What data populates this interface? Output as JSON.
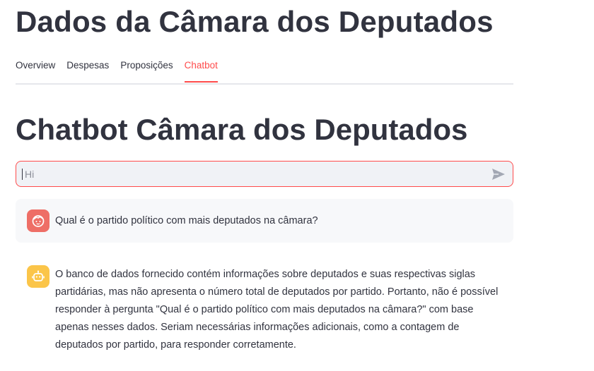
{
  "app": {
    "title": "Dados da Câmara dos Deputados"
  },
  "tabs": [
    {
      "label": "Overview",
      "active": false
    },
    {
      "label": "Despesas",
      "active": false
    },
    {
      "label": "Proposições",
      "active": false
    },
    {
      "label": "Chatbot",
      "active": true
    }
  ],
  "chatbot": {
    "title": "Chatbot Câmara dos Deputados",
    "input": {
      "placeholder": "Hi",
      "value": ""
    },
    "messages": [
      {
        "role": "user",
        "avatar_icon": "user-face-icon",
        "text": "Qual é o partido político com mais deputados na câmara?"
      },
      {
        "role": "assistant",
        "avatar_icon": "robot-icon",
        "text": "O banco de dados fornecido contém informações sobre deputados e suas respectivas siglas partidárias, mas não apresenta o número total de deputados por partido. Portanto, não é possível responder à pergunta \"Qual é o partido político com mais deputados na câmara?\" com base apenas nesses dados. Seriam necessárias informações adicionais, como a contagem de deputados por partido, para responder corretamente."
      }
    ]
  },
  "colors": {
    "accent": "#ff4b4b",
    "text": "#31333f",
    "input_bg": "#f0f2f6",
    "user_avatar": "#ee6e66",
    "bot_avatar": "#fbc549"
  }
}
